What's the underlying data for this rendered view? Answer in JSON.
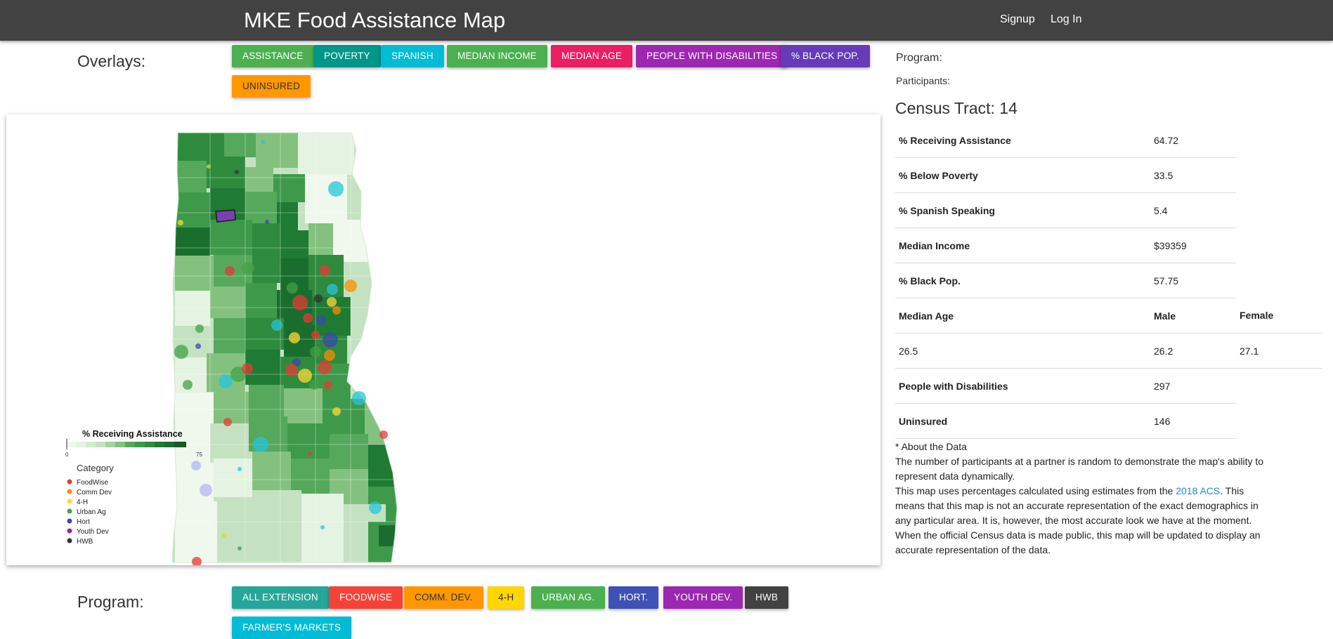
{
  "header": {
    "title": "MKE Food Assistance Map",
    "signup": "Signup",
    "login": "Log In"
  },
  "overlays": {
    "label": "Overlays:",
    "buttons": [
      {
        "label": "ASSISTANCE",
        "color": "#4caf50"
      },
      {
        "label": "POVERTY",
        "color": "#009688"
      },
      {
        "label": "SPANISH",
        "color": "#00bcd4"
      },
      {
        "label": "MEDIAN INCOME",
        "color": "#4caf50"
      },
      {
        "label": "MEDIAN AGE",
        "color": "#e91e63"
      },
      {
        "label": "PEOPLE WITH DISABILITIES",
        "color": "#9c27b0"
      },
      {
        "label": "% BLACK POP.",
        "color": "#673ab7"
      },
      {
        "label": "UNINSURED",
        "color": "#ff9800"
      }
    ]
  },
  "legend": {
    "title": "% Receiving Assistance",
    "min": "0",
    "max": "75",
    "category_title": "Category",
    "categories": [
      {
        "name": "FoodWise",
        "color": "#e53935"
      },
      {
        "name": "Comm Dev",
        "color": "#fb8c00"
      },
      {
        "name": "4-H",
        "color": "#fdd835"
      },
      {
        "name": "Urban Ag",
        "color": "#43a047"
      },
      {
        "name": "Hort",
        "color": "#3949ab"
      },
      {
        "name": "Youth Dev",
        "color": "#8e24aa"
      },
      {
        "name": "HWB",
        "color": "#333333"
      }
    ]
  },
  "sidebar": {
    "program_label": "Program:",
    "participants_label": "Participants:",
    "tract_title": "Census Tract: 14",
    "stats": {
      "receiving": {
        "label": "% Receiving Assistance",
        "value": "64.72"
      },
      "poverty": {
        "label": "% Below Poverty",
        "value": "33.5"
      },
      "spanish": {
        "label": "% Spanish Speaking",
        "value": "5.4"
      },
      "income": {
        "label": "Median Income",
        "value": "$39359"
      },
      "black": {
        "label": "% Black Pop.",
        "value": "57.75"
      },
      "age": {
        "label": "Median Age",
        "male_label": "Male",
        "female_label": "Female",
        "value": "26.5",
        "male": "26.2",
        "female": "27.1"
      },
      "disabilities": {
        "label": "People with Disabilities",
        "value": "297"
      },
      "uninsured": {
        "label": "Uninsured",
        "value": "146"
      }
    },
    "about": {
      "title": "* About the Data",
      "line1": "The number of participants at a partner is random to demonstrate the map's ability to represent data dynamically.",
      "line2_pre": "This map uses percentages calculated using estimates from the ",
      "link": "2018 ACS",
      "line2_post": ". This means that this map is not an accurate representation of the exact demographics in any particular area. It is, however, the most accurate look we have at the moment. When the official Census data is made public, this map will be updated to display an accurate representation of the data."
    }
  },
  "program": {
    "label": "Program:",
    "buttons": [
      {
        "label": "ALL EXTENSION",
        "color": "#26a69a"
      },
      {
        "label": "FOODWISE",
        "color": "#f44336"
      },
      {
        "label": "COMM. DEV.",
        "color": "#ff9800"
      },
      {
        "label": "4-H",
        "color": "#ffd600"
      },
      {
        "label": "URBAN AG.",
        "color": "#4caf50"
      },
      {
        "label": "HORT.",
        "color": "#3f51b5"
      },
      {
        "label": "YOUTH DEV.",
        "color": "#9c27b0"
      },
      {
        "label": "HWB",
        "color": "#424242"
      },
      {
        "label": "FARMER'S MARKETS",
        "color": "#00bcd4"
      }
    ]
  }
}
